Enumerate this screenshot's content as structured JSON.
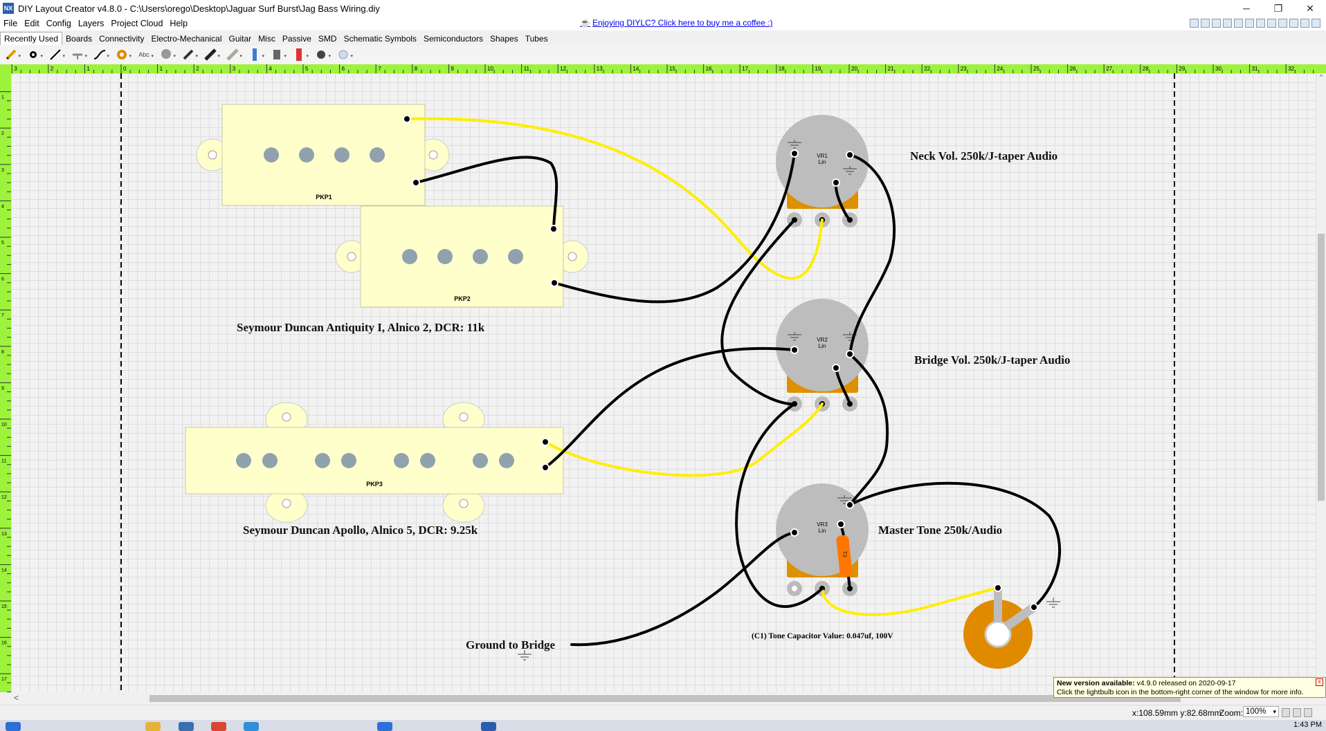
{
  "window": {
    "app_icon": "NX",
    "title": "DIY Layout Creator v4.8.0 - C:\\Users\\orego\\Desktop\\Jaguar Surf Burst\\Jag Bass Wiring.diy",
    "minimize": "─",
    "restore": "❐",
    "close": "✕"
  },
  "menu": {
    "items": [
      "File",
      "Edit",
      "Config",
      "Layers",
      "Project Cloud",
      "Help"
    ]
  },
  "banner": {
    "cup_icon": "☕",
    "text": "Enjoying DIYLC? Click here to buy me a coffee :)"
  },
  "tabs": {
    "items": [
      "Recently Used",
      "Boards",
      "Connectivity",
      "Electro-Mechanical",
      "Guitar",
      "Misc",
      "Passive",
      "SMD",
      "Schematic Symbols",
      "Semiconductors",
      "Shapes",
      "Tubes"
    ],
    "active": "Recently Used"
  },
  "toolbar": {
    "text_tool_label": "Abc"
  },
  "rulers": {
    "top_labels": [
      "3",
      "2",
      "1",
      "0",
      "1",
      "2",
      "3",
      "4",
      "5",
      "6",
      "7",
      "8",
      "9",
      "10",
      "11",
      "12",
      "13",
      "14",
      "15",
      "16",
      "17",
      "18",
      "19",
      "20",
      "21",
      "22",
      "23",
      "24",
      "25",
      "26",
      "27",
      "28",
      "29",
      "30",
      "31",
      "32"
    ],
    "left_labels": [
      "1",
      "2",
      "3",
      "4",
      "5",
      "6",
      "7",
      "8",
      "9",
      "10",
      "11",
      "12",
      "13",
      "14",
      "15",
      "16",
      "17",
      "18"
    ]
  },
  "layout": {
    "pickups": {
      "pkp1": "PKP1",
      "pkp2": "PKP2",
      "pkp3": "PKP3"
    },
    "pots": {
      "vr1_name": "VR1",
      "vr2_name": "VR2",
      "vr3_name": "VR3",
      "taper": "Lin"
    },
    "capacitor_label": "C1",
    "labels": {
      "pickup_desc_1": "Seymour Duncan Antiquity I, Alnico 2, DCR: 11k",
      "pickup_desc_2": "Seymour Duncan Apollo, Alnico 5, DCR: 9.25k",
      "neck_vol": "Neck Vol. 250k/J-taper Audio",
      "bridge_vol": "Bridge Vol. 250k/J-taper Audio",
      "master_tone": "Master Tone 250k/Audio",
      "tone_cap": "(C1) Tone Capacitor Value: 0.047uf, 100V",
      "ground": "Ground to Bridge"
    },
    "colors": {
      "pickup_fill": "#ffffcc",
      "pole": "#8fa2ad",
      "wire_hot": "#ffee00",
      "wire_ground": "#000000",
      "pot_body": "#bdbdbd",
      "pot_lug": "#dd9000",
      "jack": "#e08a00",
      "capacitor": "#ff7700",
      "ruler": "#9df23b"
    }
  },
  "notification": {
    "title": "New version available:",
    "line1": " v4.9.0 released on 2020-09-17",
    "line2": "Click the lightbulb icon in the bottom-right corner of the window for more info.",
    "close": "x"
  },
  "status": {
    "coords": "x:108.59mm y:82.68mm",
    "zoom_label": "Zoom:",
    "zoom": "100%",
    "zoom_chevron": "▾"
  },
  "scroll": {
    "left": "<",
    "up": "^"
  },
  "taskbar": {
    "clock": "1:43 PM"
  }
}
